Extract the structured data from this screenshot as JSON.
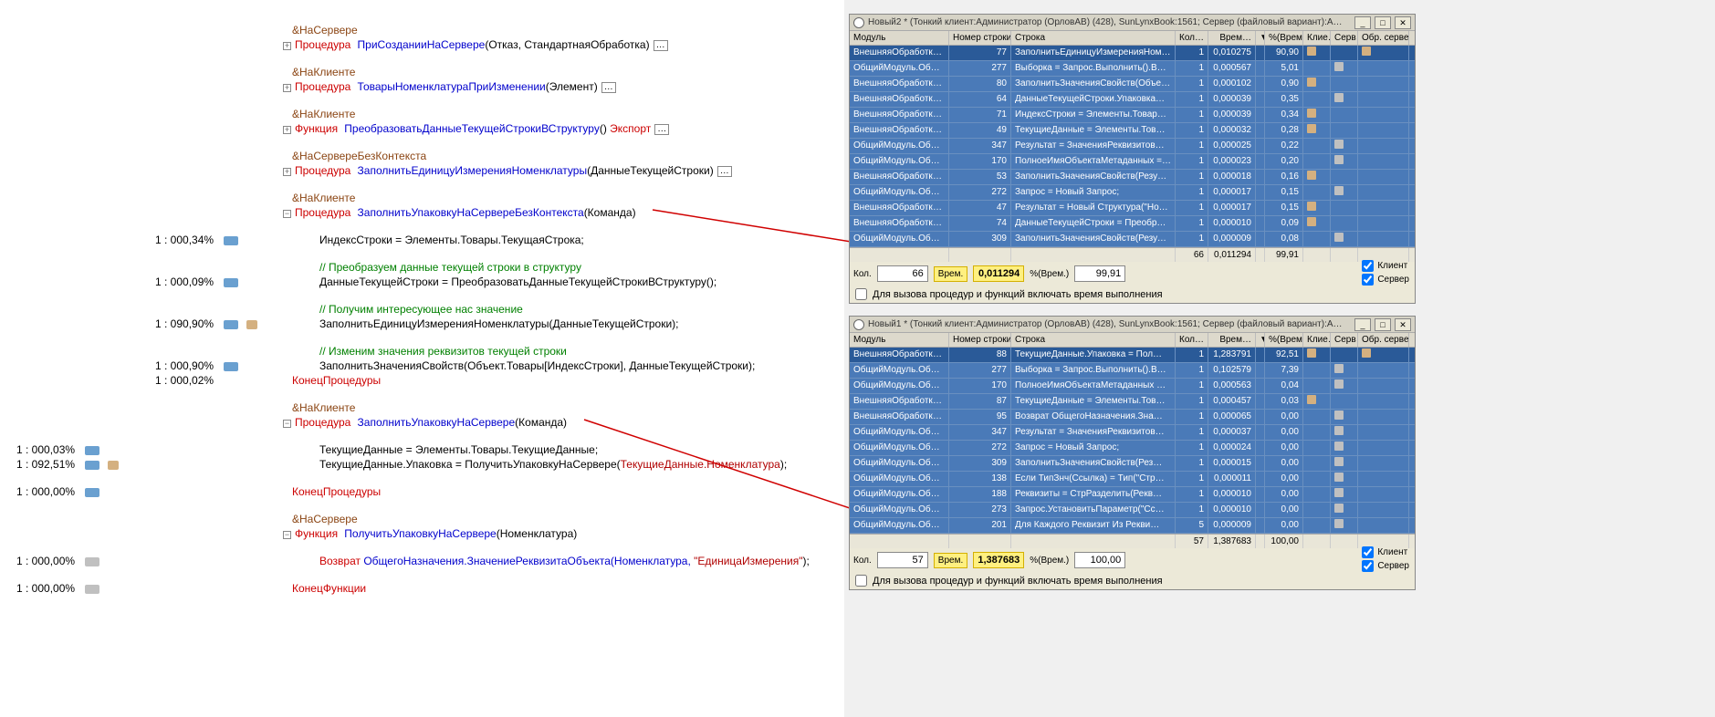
{
  "code": {
    "l1_dir": "&НаСервере",
    "l2_kw": "Процедура",
    "l2_name": "ПриСозданииНаСервере",
    "l2_args": "(Отказ, СтандартнаяОбработка)",
    "l3_dir": "&НаКлиенте",
    "l4_kw": "Процедура",
    "l4_name": "ТоварыНоменклатураПриИзменении",
    "l4_args": "(Элемент)",
    "l5_dir": "&НаКлиенте",
    "l6_kw": "Функция",
    "l6_name": "ПреобразоватьДанныеТекущейСтрокиВСтруктуру",
    "l6_parens": "()",
    "l6_exp": " Экспорт",
    "l7_dir": "&НаСервереБезКонтекста",
    "l8_kw": "Процедура",
    "l8_name": "ЗаполнитьЕдиницуИзмеренияНоменклатуры",
    "l8_args": "(ДанныеТекущейСтроки)",
    "l9_dir": "&НаКлиенте",
    "l10_kw": "Процедура",
    "l10_name": "ЗаполнитьУпаковкуНаСервереБезКонтекста",
    "l10_args": "(Команда)",
    "l11": "ИндексСтроки = Элементы.Товары.ТекущаяСтрока;",
    "l12c": "// Преобразуем данные текущей строки в структуру",
    "l13": "ДанныеТекущейСтроки = ПреобразоватьДанныеТекущейСтрокиВСтруктуру();",
    "l14c": "// Получим интересующее нас значение",
    "l15": "ЗаполнитьЕдиницуИзмеренияНоменклатуры(ДанныеТекущейСтроки);",
    "l16c": "// Изменим значения реквизитов текущей строки",
    "l17": "ЗаполнитьЗначенияСвойств(Объект.Товары[ИндексСтроки], ДанныеТекущейСтроки);",
    "l18": "КонецПроцедуры",
    "l19_dir": "&НаКлиенте",
    "l20_kw": "Процедура",
    "l20_name": "ЗаполнитьУпаковкуНаСервере",
    "l20_args": "(Команда)",
    "l21": "ТекущиеДанные = Элементы.Товары.ТекущиеДанные;",
    "l22a": "ТекущиеДанные.Упаковка = ПолучитьУпаковкуНаСервере(",
    "l22b": "ТекущиеДанные.Номенклатура",
    "l22c": ");",
    "l23": "КонецПроцедуры",
    "l24_dir": "&НаСервере",
    "l25_kw": "Функция",
    "l25_name": "ПолучитьУпаковкуНаСервере",
    "l25_args": "(Номенклатура)",
    "l26_kw": "Возврат ",
    "l26_body": "ОбщегоНазначения.ЗначениеРеквизитаОбъекта(Номенклатура, ",
    "l26_str": "\"ЕдиницаИзмерения\"",
    "l26_end": ");",
    "l27": "КонецФункции"
  },
  "gutter": {
    "g_l11": "1 : 000,34%",
    "g_l13": "1 : 000,09%",
    "g_l15": "1 : 090,90%",
    "g_l17": "1 : 000,90%",
    "g_l18": "1 : 000,02%",
    "g_l21": "1 : 000,03%",
    "g_l22": "1 : 092,51%",
    "g_l23": "1 : 000,00%",
    "g_l26": "1 : 000,00%",
    "g_l27": "1 : 000,00%"
  },
  "profilers": [
    {
      "title": "Новый2 *   (Тонкий клиент:Администратор (ОрловАВ) (428), SunLynxBook:1561; Сервер (файловый вариант):А…",
      "headers": {
        "mod": "Модуль",
        "line": "Номер строки",
        "str": "Строка",
        "n": "Кол…",
        "t": "Врем…",
        "sort": "▼",
        "pct": "%(Врем.)",
        "cli": "Клие…",
        "srv": "Серв…",
        "obr": "Обр. серве…"
      },
      "rows": [
        {
          "mod": "ВнешняяОбработка.З…",
          "line": "77",
          "str": "ЗаполнитьЕдиницуИзмеренияНом…",
          "n": "1",
          "t": "0,010275",
          "pct": "90,90",
          "cli": true,
          "srv": false,
          "obr": true
        },
        {
          "mod": "ОбщийМодуль.Общег…",
          "line": "277",
          "str": "Выборка = Запрос.Выполнить().Вы…",
          "n": "1",
          "t": "0,000567",
          "pct": "5,01",
          "cli": false,
          "srv": true,
          "obr": false
        },
        {
          "mod": "ВнешняяОбработка.З…",
          "line": "80",
          "str": "ЗаполнитьЗначенияСвойств(Объе…",
          "n": "1",
          "t": "0,000102",
          "pct": "0,90",
          "cli": true,
          "srv": false,
          "obr": false
        },
        {
          "mod": "ВнешняяОбработка.З…",
          "line": "64",
          "str": "ДанныеТекущейСтроки.Упаковка…",
          "n": "1",
          "t": "0,000039",
          "pct": "0,35",
          "cli": false,
          "srv": true,
          "obr": false
        },
        {
          "mod": "ВнешняяОбработка.З…",
          "line": "71",
          "str": "ИндексСтроки = Элементы.Товар…",
          "n": "1",
          "t": "0,000039",
          "pct": "0,34",
          "cli": true,
          "srv": false,
          "obr": false
        },
        {
          "mod": "ВнешняяОбработка.З…",
          "line": "49",
          "str": "ТекущиеДанные = Элементы.Тов…",
          "n": "1",
          "t": "0,000032",
          "pct": "0,28",
          "cli": true,
          "srv": false,
          "obr": false
        },
        {
          "mod": "ОбщийМодуль.Общег…",
          "line": "347",
          "str": "Результат = ЗначенияРеквизитов…",
          "n": "1",
          "t": "0,000025",
          "pct": "0,22",
          "cli": false,
          "srv": true,
          "obr": false
        },
        {
          "mod": "ОбщийМодуль.Общег…",
          "line": "170",
          "str": "ПолноеИмяОбъектаМетаданных = …",
          "n": "1",
          "t": "0,000023",
          "pct": "0,20",
          "cli": false,
          "srv": true,
          "obr": false
        },
        {
          "mod": "ВнешняяОбработка.З…",
          "line": "53",
          "str": "ЗаполнитьЗначенияСвойств(Резу…",
          "n": "1",
          "t": "0,000018",
          "pct": "0,16",
          "cli": true,
          "srv": false,
          "obr": false
        },
        {
          "mod": "ОбщийМодуль.Общег…",
          "line": "272",
          "str": "Запрос = Новый Запрос;",
          "n": "1",
          "t": "0,000017",
          "pct": "0,15",
          "cli": false,
          "srv": true,
          "obr": false
        },
        {
          "mod": "ВнешняяОбработка.З…",
          "line": "47",
          "str": "Результат = Новый Структура(\"Но…",
          "n": "1",
          "t": "0,000017",
          "pct": "0,15",
          "cli": true,
          "srv": false,
          "obr": false
        },
        {
          "mod": "ВнешняяОбработка.З…",
          "line": "74",
          "str": "ДанныеТекущейСтроки = Преобр…",
          "n": "1",
          "t": "0,000010",
          "pct": "0,09",
          "cli": true,
          "srv": false,
          "obr": false
        },
        {
          "mod": "ОбщийМодуль.Общег…",
          "line": "309",
          "str": "ЗаполнитьЗначенияСвойств(Резул…",
          "n": "1",
          "t": "0,000009",
          "pct": "0,08",
          "cli": false,
          "srv": true,
          "obr": false
        }
      ],
      "totals": {
        "n": "66",
        "t": "0,011294",
        "pct": "99,91"
      },
      "footer": {
        "n_label": "Кол.",
        "n_val": "66",
        "t_label": "Врем.",
        "t_val": "0,011294",
        "pct_label": "%(Врем.)",
        "pct_val": "99,91"
      },
      "chk_label": "Для вызова процедур и функций включать время выполнения",
      "client_label": "Клиент",
      "server_label": "Сервер"
    },
    {
      "title": "Новый1 *   (Тонкий клиент:Администратор (ОрловАВ) (428), SunLynxBook:1561; Сервер (файловый вариант):А…",
      "headers": {
        "mod": "Модуль",
        "line": "Номер строки",
        "str": "Строка",
        "n": "Кол…",
        "t": "Врем…",
        "sort": "▼",
        "pct": "%(Врем.)",
        "cli": "Клие…",
        "srv": "Серв…",
        "obr": "Обр. серве…"
      },
      "rows": [
        {
          "mod": "ВнешняяОбработка.З…",
          "line": "88",
          "str": "ТекущиеДанные.Упаковка = Пол…",
          "n": "1",
          "t": "1,283791",
          "pct": "92,51",
          "cli": true,
          "srv": false,
          "obr": true
        },
        {
          "mod": "ОбщийМодуль.Общег…",
          "line": "277",
          "str": "Выборка = Запрос.Выполнить().В…",
          "n": "1",
          "t": "0,102579",
          "pct": "7,39",
          "cli": false,
          "srv": true,
          "obr": false
        },
        {
          "mod": "ОбщийМодуль.Общег…",
          "line": "170",
          "str": "ПолноеИмяОбъектаМетаданных …",
          "n": "1",
          "t": "0,000563",
          "pct": "0,04",
          "cli": false,
          "srv": true,
          "obr": false
        },
        {
          "mod": "ВнешняяОбработка.З…",
          "line": "87",
          "str": "ТекущиеДанные = Элементы.Тов…",
          "n": "1",
          "t": "0,000457",
          "pct": "0,03",
          "cli": true,
          "srv": false,
          "obr": false
        },
        {
          "mod": "ВнешняяОбработка.З…",
          "line": "95",
          "str": "Возврат ОбщегоНазначения.Зна…",
          "n": "1",
          "t": "0,000065",
          "pct": "0,00",
          "cli": false,
          "srv": true,
          "obr": false
        },
        {
          "mod": "ОбщийМодуль.Общег…",
          "line": "347",
          "str": "Результат = ЗначенияРеквизитов…",
          "n": "1",
          "t": "0,000037",
          "pct": "0,00",
          "cli": false,
          "srv": true,
          "obr": false
        },
        {
          "mod": "ОбщийМодуль.Общег…",
          "line": "272",
          "str": "Запрос = Новый Запрос;",
          "n": "1",
          "t": "0,000024",
          "pct": "0,00",
          "cli": false,
          "srv": true,
          "obr": false
        },
        {
          "mod": "ОбщийМодуль.Общег…",
          "line": "309",
          "str": "ЗаполнитьЗначенияСвойств(Рез…",
          "n": "1",
          "t": "0,000015",
          "pct": "0,00",
          "cli": false,
          "srv": true,
          "obr": false
        },
        {
          "mod": "ОбщийМодуль.Общег…",
          "line": "138",
          "str": "Если ТипЗнч(Ссылка) = Тип(\"Стр…",
          "n": "1",
          "t": "0,000011",
          "pct": "0,00",
          "cli": false,
          "srv": true,
          "obr": false
        },
        {
          "mod": "ОбщийМодуль.Общег…",
          "line": "188",
          "str": "Реквизиты = СтрРазделить(Рекв…",
          "n": "1",
          "t": "0,000010",
          "pct": "0,00",
          "cli": false,
          "srv": true,
          "obr": false
        },
        {
          "mod": "ОбщийМодуль.Общег…",
          "line": "273",
          "str": "Запрос.УстановитьПараметр(\"Сс…",
          "n": "1",
          "t": "0,000010",
          "pct": "0,00",
          "cli": false,
          "srv": true,
          "obr": false
        },
        {
          "mod": "ОбщийМодуль.Общег…",
          "line": "201",
          "str": "Для Каждого Реквизит Из Рекви…",
          "n": "5",
          "t": "0,000009",
          "pct": "0,00",
          "cli": false,
          "srv": true,
          "obr": false
        }
      ],
      "totals": {
        "n": "57",
        "t": "1,387683",
        "pct": "100,00"
      },
      "footer": {
        "n_label": "Кол.",
        "n_val": "57",
        "t_label": "Врем.",
        "t_val": "1,387683",
        "pct_label": "%(Врем.)",
        "pct_val": "100,00"
      },
      "chk_label": "Для вызова процедур и функций включать время выполнения",
      "client_label": "Клиент",
      "server_label": "Сервер"
    }
  ]
}
